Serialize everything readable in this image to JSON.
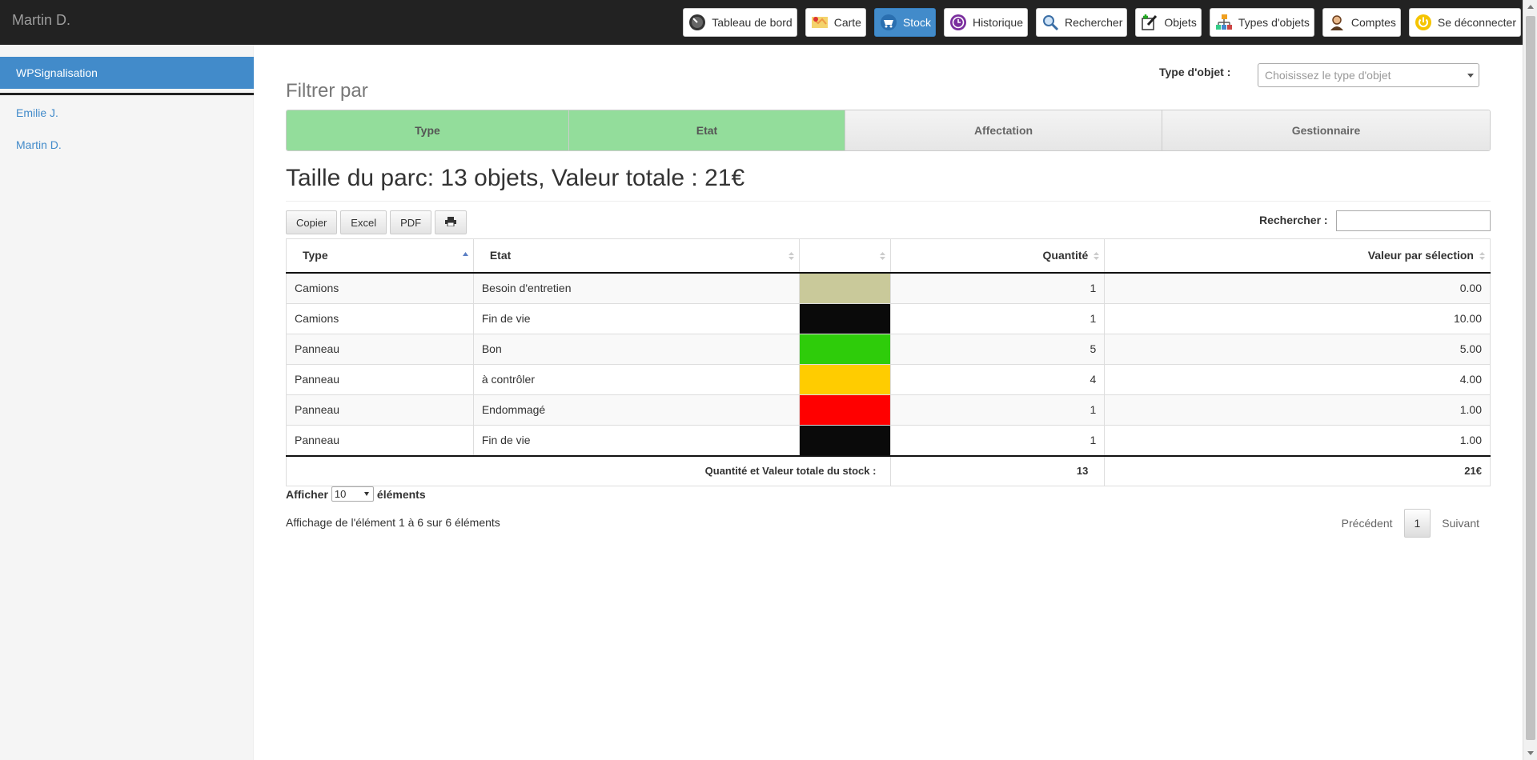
{
  "navbar": {
    "brand": "Martin D.",
    "buttons": [
      {
        "label": "Tableau de bord",
        "icon": "dashboard-gauge-icon"
      },
      {
        "label": "Carte",
        "icon": "map-icon"
      },
      {
        "label": "Stock",
        "icon": "cart-icon",
        "active": true
      },
      {
        "label": "Historique",
        "icon": "history-clock-icon"
      },
      {
        "label": "Rechercher",
        "icon": "magnifier-icon"
      },
      {
        "label": "Objets",
        "icon": "edit-objects-icon"
      },
      {
        "label": "Types d'objets",
        "icon": "hierarchy-icon"
      },
      {
        "label": "Comptes",
        "icon": "user-accounts-icon"
      },
      {
        "label": "Se déconnecter",
        "icon": "power-icon"
      }
    ]
  },
  "sidebar": {
    "active_item": "WPSignalisation",
    "links": [
      "Emilie J.",
      "Martin D."
    ]
  },
  "filter": {
    "title": "Filtrer par",
    "type_label": "Type d'objet :",
    "type_placeholder": "Choisissez le type d'objet",
    "tabs": [
      {
        "label": "Type",
        "selected": true
      },
      {
        "label": "Etat",
        "selected": true
      },
      {
        "label": "Affectation",
        "selected": false
      },
      {
        "label": "Gestionnaire",
        "selected": false
      }
    ]
  },
  "summary": "Taille du parc: 13 objets, Valeur totale : 21€",
  "toolbar": {
    "copy": "Copier",
    "excel": "Excel",
    "pdf": "PDF",
    "print_icon": "print-icon",
    "search_label": "Rechercher :"
  },
  "table": {
    "headers": [
      "Type",
      "Etat",
      "",
      "Quantité",
      "Valeur par sélection"
    ],
    "rows": [
      {
        "type": "Camions",
        "etat": "Besoin d'entretien",
        "color": "#c9c99a",
        "qty": "1",
        "value": "0.00"
      },
      {
        "type": "Camions",
        "etat": "Fin de vie",
        "color": "#0a0a0a",
        "qty": "1",
        "value": "10.00"
      },
      {
        "type": "Panneau",
        "etat": "Bon",
        "color": "#2ecc0a",
        "qty": "5",
        "value": "5.00"
      },
      {
        "type": "Panneau",
        "etat": "à contrôler",
        "color": "#ffcc00",
        "qty": "4",
        "value": "4.00"
      },
      {
        "type": "Panneau",
        "etat": "Endommagé",
        "color": "#ff0000",
        "qty": "1",
        "value": "1.00"
      },
      {
        "type": "Panneau",
        "etat": "Fin de vie",
        "color": "#0a0a0a",
        "qty": "1",
        "value": "1.00"
      }
    ],
    "footer": {
      "label": "Quantité et Valeur totale du stock :",
      "qty": "13",
      "value": "21€"
    }
  },
  "length": {
    "prefix": "Afficher",
    "value": "10",
    "suffix": "éléments"
  },
  "info": "Affichage de l'élément 1 à 6 sur 6 éléments",
  "pagination": {
    "prev": "Précédent",
    "current": "1",
    "next": "Suivant"
  }
}
